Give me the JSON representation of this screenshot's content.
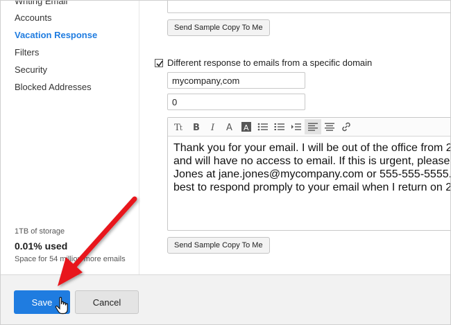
{
  "sidebar": {
    "items": [
      {
        "label": "Writing Email"
      },
      {
        "label": "Accounts"
      },
      {
        "label": "Vacation Response"
      },
      {
        "label": "Filters"
      },
      {
        "label": "Security"
      },
      {
        "label": "Blocked Addresses"
      }
    ],
    "storage": {
      "total": "1TB of storage",
      "used": "0.01% used",
      "space": "Space for 54 million more emails"
    }
  },
  "main": {
    "send_sample_label": "Send Sample Copy To Me",
    "domain_checkbox": {
      "label": "Different response to emails from a specific domain",
      "checked": true
    },
    "domain_input": {
      "value": "mycompany,com"
    },
    "days_input": {
      "value": "0"
    },
    "editor": {
      "lines": [
        "Thank you for your email. I will be out of the office from 2",
        "and will have no access to email. If this is urgent, please",
        "Jones at jane.jones@mycompany.com or 555-555-5555.",
        "best to respond promply to your email when I return on 2"
      ]
    }
  },
  "footer": {
    "save_label": "Save",
    "cancel_label": "Cancel"
  },
  "colors": {
    "accent": "#1f7ce0",
    "annotation_arrow": "#e8151b"
  }
}
